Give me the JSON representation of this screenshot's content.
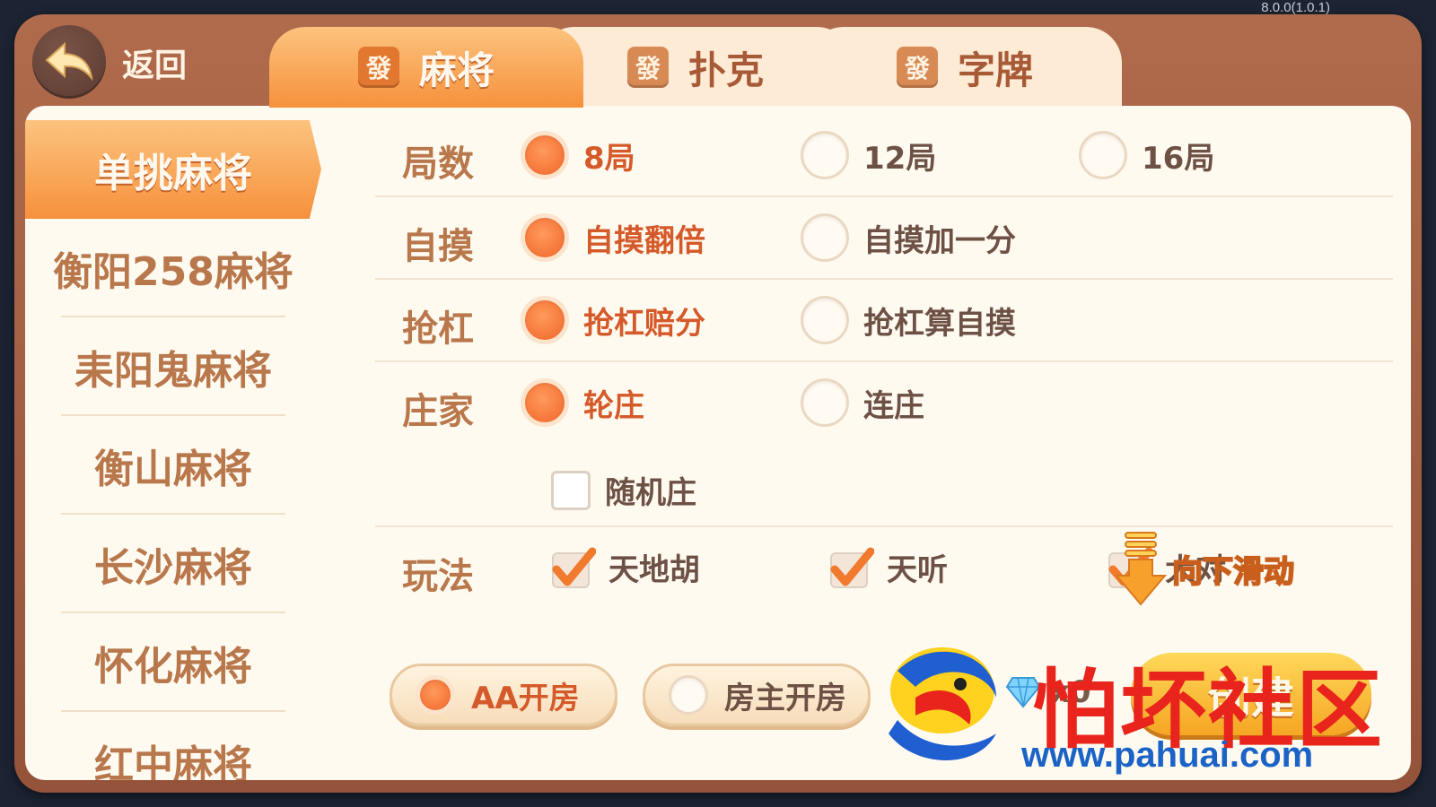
{
  "version": "8.0.0(1.0.1)",
  "header": {
    "back_label": "返回",
    "tabs": [
      {
        "label": "麻将",
        "icon": "發",
        "active": true
      },
      {
        "label": "扑克",
        "icon": "發",
        "active": false
      },
      {
        "label": "字牌",
        "icon": "發",
        "active": false
      }
    ]
  },
  "game_list": [
    {
      "label": "单挑麻将",
      "active": true
    },
    {
      "label": "衡阳258麻将",
      "active": false
    },
    {
      "label": "耒阳鬼麻将",
      "active": false
    },
    {
      "label": "衡山麻将",
      "active": false
    },
    {
      "label": "长沙麻将",
      "active": false
    },
    {
      "label": "怀化麻将",
      "active": false
    },
    {
      "label": "红中麻将",
      "active": false
    }
  ],
  "options": {
    "rounds": {
      "label": "局数",
      "choices": [
        {
          "label": "8局",
          "selected": true
        },
        {
          "label": "12局",
          "selected": false
        },
        {
          "label": "16局",
          "selected": false
        }
      ]
    },
    "self_draw": {
      "label": "自摸",
      "choices": [
        {
          "label": "自摸翻倍",
          "selected": true
        },
        {
          "label": "自摸加一分",
          "selected": false
        }
      ]
    },
    "rob_kong": {
      "label": "抢杠",
      "choices": [
        {
          "label": "抢杠赔分",
          "selected": true
        },
        {
          "label": "抢杠算自摸",
          "selected": false
        }
      ]
    },
    "dealer": {
      "label": "庄家",
      "choices": [
        {
          "label": "轮庄",
          "selected": true
        },
        {
          "label": "连庄",
          "selected": false
        }
      ],
      "random_dealer": {
        "label": "随机庄",
        "checked": false
      }
    },
    "rules": {
      "label": "玩法",
      "choices": [
        {
          "label": "天地胡",
          "checked": true
        },
        {
          "label": "天听",
          "checked": true
        },
        {
          "label": "大对",
          "checked": true
        }
      ]
    }
  },
  "scroll_hint": "向下滑动",
  "room_types": [
    {
      "label": "AA开房",
      "selected": true
    },
    {
      "label": "房主开房",
      "selected": false
    }
  ],
  "cost": "x0",
  "create_label": "创建",
  "watermark": {
    "text": "怕坏社区",
    "url": "www.pahuai.com"
  }
}
